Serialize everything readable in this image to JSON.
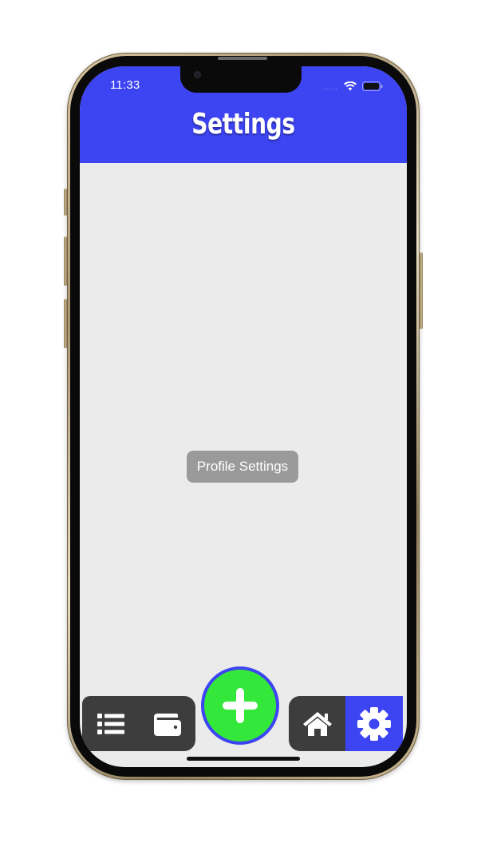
{
  "status_bar": {
    "time": "11:33",
    "signal_dots": "....."
  },
  "header": {
    "title": "Settings",
    "color": "#3d44f2"
  },
  "main": {
    "profile_button_label": "Profile Settings"
  },
  "bottom_nav": {
    "items": [
      {
        "icon": "list-icon",
        "active": false
      },
      {
        "icon": "wallet-icon",
        "active": false
      },
      {
        "icon": "plus-icon",
        "active": false
      },
      {
        "icon": "home-icon",
        "active": false
      },
      {
        "icon": "gear-icon",
        "active": true
      }
    ],
    "accent_color": "#3d44f2",
    "fab_color": "#33e83a",
    "bar_color": "#3d3d3d"
  }
}
